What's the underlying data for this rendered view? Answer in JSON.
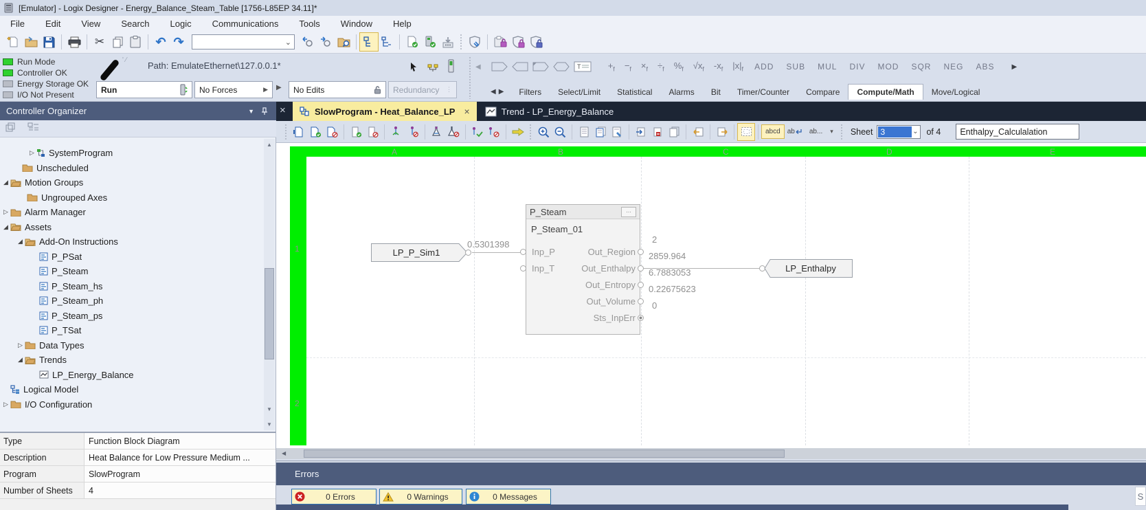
{
  "window": {
    "title": "[Emulator] - Logix Designer - Energy_Balance_Steam_Table [1756-L85EP 34.11]*"
  },
  "menu_bar": {
    "items": [
      "File",
      "Edit",
      "View",
      "Search",
      "Logic",
      "Communications",
      "Tools",
      "Window",
      "Help"
    ]
  },
  "quick_find": {
    "value": ""
  },
  "status_leds": [
    {
      "label": "Run Mode",
      "state": "on"
    },
    {
      "label": "Controller OK",
      "state": "on"
    },
    {
      "label": "Energy Storage OK",
      "state": "off"
    },
    {
      "label": "I/O Not Present",
      "state": "off"
    }
  ],
  "connection": {
    "path_label": "Path: EmulateEthernet\\127.0.0.1*",
    "mode": "Run",
    "forces": "No Forces",
    "edits": "No Edits",
    "redundancy": "Redundancy"
  },
  "palette": {
    "func_ops": [
      "+",
      "−",
      "×",
      "÷",
      "%",
      "√x",
      "-x",
      "|x|"
    ],
    "func_sub": "f",
    "word_ops": [
      "ADD",
      "SUB",
      "MUL",
      "DIV",
      "MOD",
      "SQR",
      "NEG",
      "ABS"
    ],
    "tabs": [
      "Filters",
      "Select/Limit",
      "Statistical",
      "Alarms",
      "Bit",
      "Timer/Counter",
      "Compare",
      "Compute/Math",
      "Move/Logical"
    ],
    "active_tab": "Compute/Math"
  },
  "organizer": {
    "title": "Controller Organizer",
    "items": [
      {
        "label": "SystemProgram"
      },
      {
        "label": "Unscheduled"
      },
      {
        "label": "Motion Groups"
      },
      {
        "label": "Ungrouped Axes"
      },
      {
        "label": "Alarm Manager"
      },
      {
        "label": "Assets"
      },
      {
        "label": "Add-On Instructions"
      },
      {
        "label": "P_PSat"
      },
      {
        "label": "P_Steam"
      },
      {
        "label": "P_Steam_hs"
      },
      {
        "label": "P_Steam_ph"
      },
      {
        "label": "P_Steam_ps"
      },
      {
        "label": "P_TSat"
      },
      {
        "label": "Data Types"
      },
      {
        "label": "Trends"
      },
      {
        "label": "LP_Energy_Balance"
      },
      {
        "label": "Logical Model"
      },
      {
        "label": "I/O Configuration"
      }
    ]
  },
  "quick_props": {
    "rows": [
      {
        "label": "Type",
        "value": "Function Block Diagram"
      },
      {
        "label": "Description",
        "value": "Heat Balance for Low Pressure Medium ..."
      },
      {
        "label": "Program",
        "value": "SlowProgram"
      },
      {
        "label": "Number of Sheets",
        "value": "4"
      }
    ]
  },
  "editor": {
    "tabs": [
      {
        "label": "SlowProgram - Heat_Balance_LP"
      },
      {
        "label": "Trend - LP_Energy_Balance"
      }
    ],
    "toolbar": {
      "abcd": "abcd",
      "ab_wrap": "ab",
      "ab_more": "ab...",
      "sheet_label": "Sheet",
      "sheet_number": "3",
      "sheet_total": "of 4",
      "section_name": "Enthalpy_Calculalation"
    }
  },
  "sheet": {
    "columns": [
      "A",
      "B",
      "C",
      "D",
      "E"
    ],
    "row_labels": [
      "1",
      "2"
    ]
  },
  "diagram": {
    "input_ref": {
      "label": "LP_P_Sim1",
      "value": "0.5301398"
    },
    "block": {
      "type": "P_Steam",
      "tag": "P_Steam_01",
      "more": "...",
      "input_pins": [
        "Inp_P",
        "Inp_T"
      ],
      "output_pins": [
        "Out_Region",
        "Out_Enthalpy",
        "Out_Entropy",
        "Out_Volume",
        "Sts_InpErr"
      ],
      "output_values": [
        "2",
        "2859.964",
        "6.7883053",
        "0.22675623",
        "0"
      ]
    },
    "output_ref": {
      "label": "LP_Enthalpy"
    }
  },
  "errors_panel": {
    "title": "Errors",
    "buttons": [
      "0 Errors",
      "0 Warnings",
      "0 Messages"
    ],
    "corner_text": "S"
  },
  "icons": {
    "undo": "↶",
    "redo": "↷",
    "cut": "✂",
    "dropdown": "▾",
    "combo_arrow": "⌄",
    "close": "×",
    "tree_collapsed": "▷",
    "tree_expanded": "◢",
    "scroll_up": "▲",
    "scroll_down": "▼",
    "scroll_left": "◀",
    "scroll_right": "▶",
    "palette_prev": "◀",
    "palette_next": "▶",
    "pane_menu": "▼"
  },
  "colors": {
    "sheet_green": "#00EE00",
    "active_tab_yellow": "#F8EC9F",
    "panel_header_slate": "#4D5C7C",
    "error_button_yellow": "#FCF4C6"
  }
}
